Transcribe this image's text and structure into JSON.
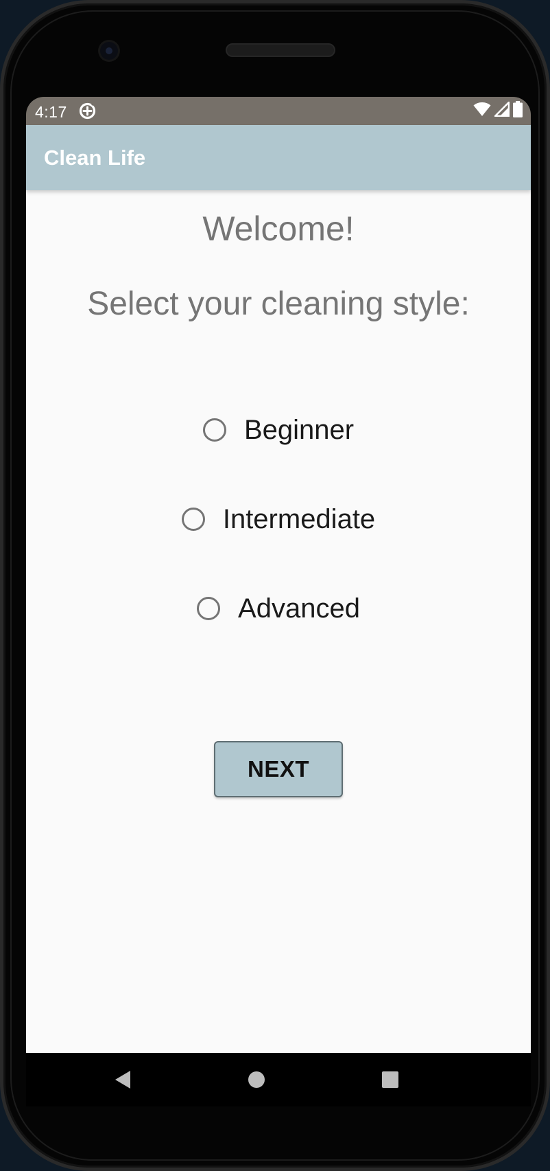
{
  "status_bar": {
    "time": "4:17",
    "icons": [
      "data-saver-icon",
      "wifi-icon",
      "cell-signal-icon",
      "battery-icon"
    ]
  },
  "app_bar": {
    "title": "Clean Life"
  },
  "main": {
    "welcome": "Welcome!",
    "subtitle": "Select your cleaning style:",
    "options": [
      {
        "label": "Beginner",
        "selected": false
      },
      {
        "label": "Intermediate",
        "selected": false
      },
      {
        "label": "Advanced",
        "selected": false
      }
    ],
    "next_label": "NEXT"
  },
  "nav_bar": {
    "icons": [
      "back-icon",
      "home-icon",
      "recents-icon"
    ]
  },
  "colors": {
    "app_bar": "#b0c7cf",
    "status_bar": "#767069",
    "background": "#fafafa",
    "secondary_text": "#757575"
  }
}
